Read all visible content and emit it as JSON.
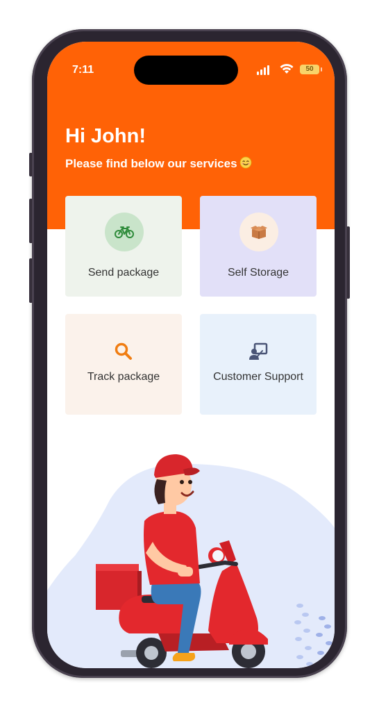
{
  "status_bar": {
    "time": "7:11",
    "battery": "50"
  },
  "header": {
    "greeting": "Hi John!",
    "subtitle": "Please find below our services",
    "subtitle_emoji": "smiling-face-icon"
  },
  "services": [
    {
      "label": "Send package",
      "icon": "bicycle-icon"
    },
    {
      "label": "Self Storage",
      "icon": "box-icon"
    },
    {
      "label": "Track package",
      "icon": "search-icon"
    },
    {
      "label": "Customer Support",
      "icon": "support-icon"
    }
  ],
  "colors": {
    "brand_orange": "#ff6206",
    "send_card": "#eef3ec",
    "storage_card": "#e2e0f8",
    "track_card": "#fbf2eb",
    "support_card": "#e8f1fb"
  }
}
